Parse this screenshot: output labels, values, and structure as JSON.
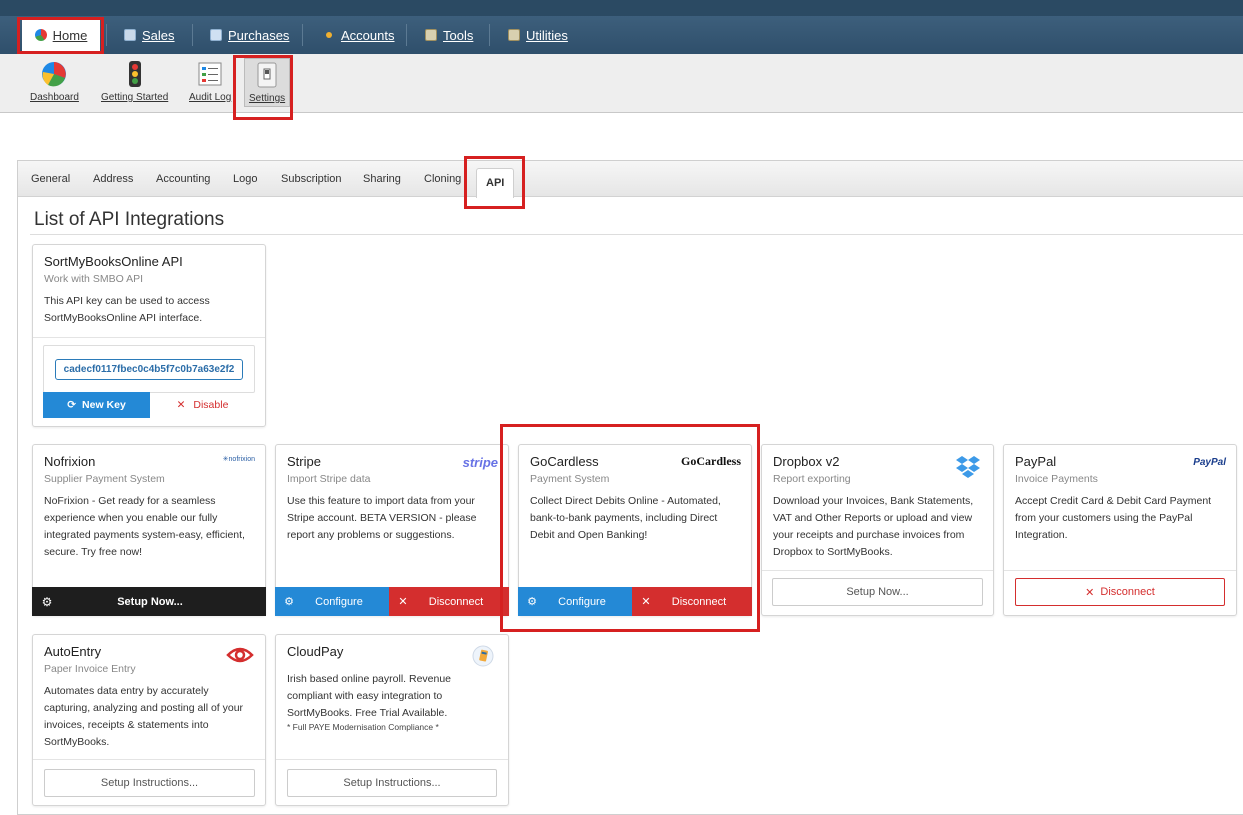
{
  "topnav": {
    "items": [
      {
        "label": "Home",
        "icon": "pie-chart-icon"
      },
      {
        "label": "Sales",
        "icon": "sales-icon"
      },
      {
        "label": "Purchases",
        "icon": "purchases-icon"
      },
      {
        "label": "Accounts",
        "icon": "accounts-icon"
      },
      {
        "label": "Tools",
        "icon": "tools-icon"
      },
      {
        "label": "Utilities",
        "icon": "utilities-icon"
      }
    ]
  },
  "toolbar": {
    "items": [
      {
        "label": "Dashboard",
        "icon": "dashboard-pie-icon"
      },
      {
        "label": "Getting Started",
        "icon": "traffic-light-icon"
      },
      {
        "label": "Audit Log",
        "icon": "audit-log-icon"
      },
      {
        "label": "Settings",
        "icon": "settings-switch-icon"
      }
    ]
  },
  "tabs": [
    "General",
    "Address",
    "Accounting",
    "Logo",
    "Subscription",
    "Sharing",
    "Cloning",
    "API"
  ],
  "page": {
    "heading": "List of API Integrations"
  },
  "smbo": {
    "title": "SortMyBooksOnline API",
    "subtitle": "Work with SMBO API",
    "desc": "This API key can be used to access SortMyBooksOnline API interface.",
    "api_key": "cadecf0117fbec0c4b5f7c0b7a63e2f2",
    "new_key": "New Key",
    "disable": "Disable"
  },
  "cards": {
    "nofrixion": {
      "title": "Nofrixion",
      "subtitle": "Supplier Payment System",
      "desc": "NoFrixion - Get ready for a seamless experience when you enable our fully integrated payments system-easy, efficient, secure. Try free now!",
      "logo": "nofrixion",
      "action": "Setup Now..."
    },
    "stripe": {
      "title": "Stripe",
      "subtitle": "Import Stripe data",
      "desc": "Use this feature to import data from your Stripe account. BETA VERSION - please report any problems or suggestions.",
      "logo": "stripe",
      "configure": "Configure",
      "disconnect": "Disconnect"
    },
    "gocardless": {
      "title": "GoCardless",
      "subtitle": "Payment System",
      "desc": "Collect Direct Debits Online - Automated, bank-to-bank payments, including Direct Debit and Open Banking!",
      "logo": "GoCardless",
      "configure": "Configure",
      "disconnect": "Disconnect"
    },
    "dropbox": {
      "title": "Dropbox v2",
      "subtitle": "Report exporting",
      "desc": "Download your Invoices, Bank Statements, VAT and Other Reports or upload and view your receipts and purchase invoices from Dropbox to SortMyBooks.",
      "action": "Setup Now..."
    },
    "paypal": {
      "title": "PayPal",
      "subtitle": "Invoice Payments",
      "desc": "Accept Credit Card & Debit Card Payment from your customers using the PayPal Integration.",
      "logo": "PayPal",
      "action": "Disconnect"
    },
    "autoentry": {
      "title": "AutoEntry",
      "subtitle": "Paper Invoice Entry",
      "desc": "Automates data entry by accurately capturing, analyzing and posting all of your invoices, receipts & statements into SortMyBooks.",
      "action": "Setup Instructions..."
    },
    "cloudpay": {
      "title": "CloudPay",
      "desc": "Irish based online payroll. Revenue compliant with easy integration to SortMyBooks. Free Trial Available.",
      "note": "* Full PAYE Modernisation Compliance *",
      "action": "Setup Instructions..."
    }
  },
  "colors": {
    "primary": "#2489d6",
    "danger": "#d42e2e",
    "nav": "#34546f",
    "highlight": "#d62020"
  }
}
